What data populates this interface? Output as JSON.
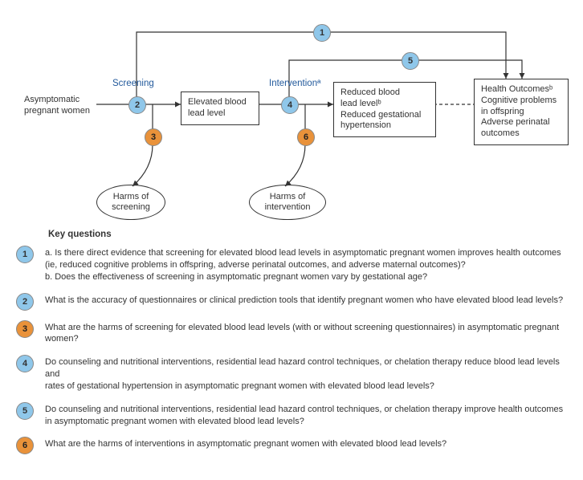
{
  "diagram": {
    "start": "Asymptomatic\npregnant women",
    "screening_label": "Screening",
    "intervention_label": "Interventionª",
    "box_elevated": "Elevated blood\nlead level",
    "box_reduced": "Reduced blood\nlead levelᵇ\nReduced gestational\nhypertension",
    "box_outcomes": "Health Outcomesᵇ\nCognitive problems\nin offspring\nAdverse perinatal\noutcomes",
    "harms_screening": "Harms of\nscreening",
    "harms_intervention": "Harms of\nintervention",
    "n1": "1",
    "n2": "2",
    "n3": "3",
    "n4": "4",
    "n5": "5",
    "n6": "6"
  },
  "key_questions": {
    "title": "Key questions",
    "items": [
      {
        "num": "1",
        "cls": "blue",
        "lines": [
          "a. Is there direct evidence that screening for elevated blood lead levels in asymptomatic pregnant women improves health outcomes",
          "    (ie, reduced cognitive problems in offspring, adverse perinatal outcomes, and adverse maternal outcomes)?",
          "b. Does the effectiveness of screening in asymptomatic pregnant women vary by gestational age?"
        ]
      },
      {
        "num": "2",
        "cls": "blue",
        "lines": [
          "What is the accuracy of questionnaires or clinical prediction tools that identify pregnant women who have elevated blood lead levels?"
        ]
      },
      {
        "num": "3",
        "cls": "orange",
        "lines": [
          "What are the harms of screening for elevated blood lead levels (with or without screening questionnaires) in asymptomatic pregnant women?"
        ]
      },
      {
        "num": "4",
        "cls": "blue",
        "lines": [
          "Do counseling and nutritional interventions, residential lead hazard control techniques, or chelation therapy reduce blood lead levels and",
          "rates of gestational hypertension in asymptomatic pregnant women with elevated blood lead levels?"
        ]
      },
      {
        "num": "5",
        "cls": "blue",
        "lines": [
          "Do counseling and nutritional interventions, residential lead hazard control techniques, or chelation therapy improve health outcomes",
          "in asymptomatic pregnant women with elevated blood lead levels?"
        ]
      },
      {
        "num": "6",
        "cls": "orange",
        "lines": [
          "What are the harms of interventions in asymptomatic pregnant women with elevated blood lead levels?"
        ]
      }
    ]
  }
}
